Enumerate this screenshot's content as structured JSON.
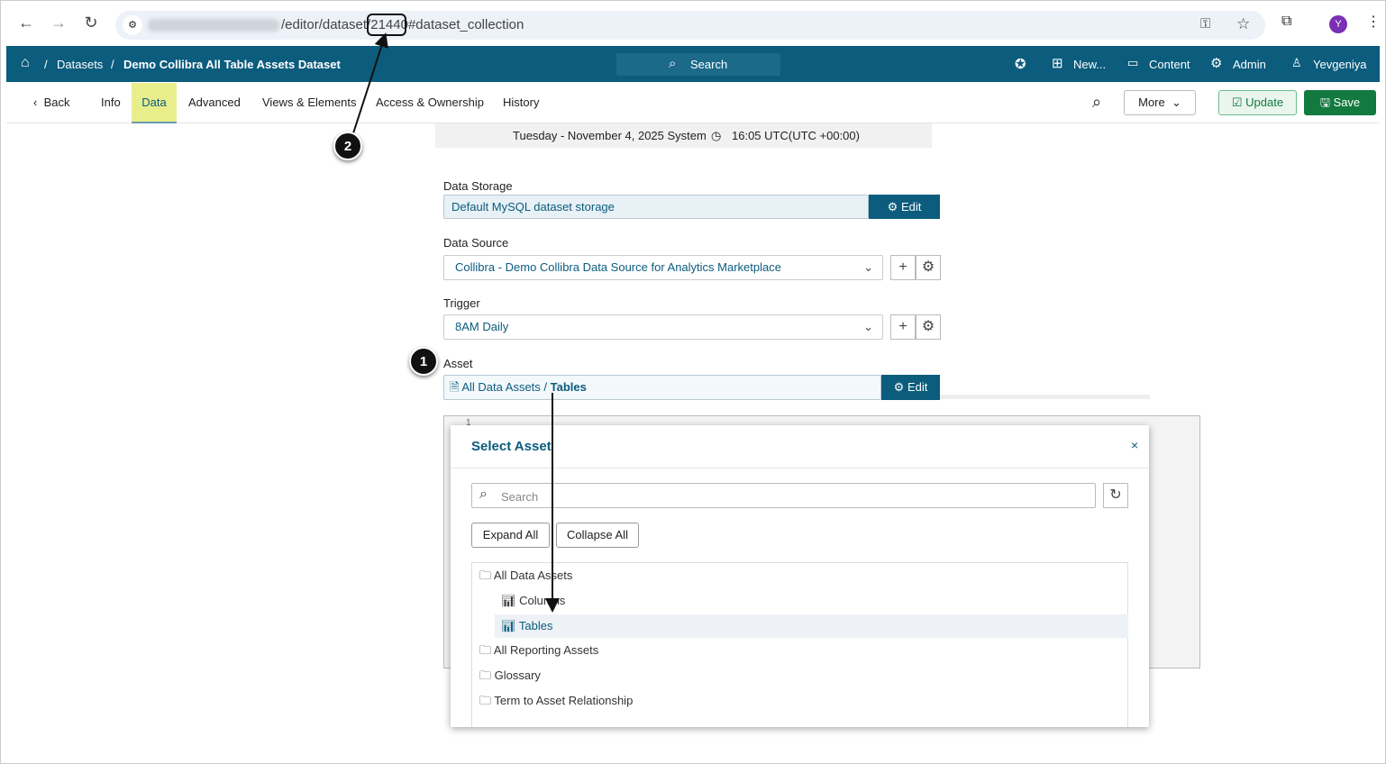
{
  "browser": {
    "url_path": "/editor/dataset/21440#dataset_collection",
    "avatar_letter": "Y"
  },
  "appbar": {
    "breadcrumb": [
      "Datasets",
      "Demo Collibra All Table Assets Dataset"
    ],
    "search": "Search",
    "new": "New...",
    "content": "Content",
    "admin": "Admin",
    "user": "Yevgeniya"
  },
  "tabs": {
    "back": "Back",
    "items": [
      "Info",
      "Data",
      "Advanced",
      "Views & Elements",
      "Access & Ownership",
      "History"
    ],
    "more": "More",
    "update": "Update",
    "save": "Save"
  },
  "datebar": {
    "date": "Tuesday - November 4, 2025 System",
    "time": "16:05 UTC(UTC +00:00)"
  },
  "form": {
    "storage_label": "Data Storage",
    "storage_value": "Default MySQL dataset storage",
    "edit": "Edit",
    "source_label": "Data Source",
    "source_value": "Collibra - Demo Collibra Data Source for Analytics Marketplace",
    "trigger_label": "Trigger",
    "trigger_value": "8AM Daily",
    "asset_label": "Asset",
    "asset_path": "All Data Assets / ",
    "asset_leaf": "Tables"
  },
  "editor": {
    "line": "1"
  },
  "modal": {
    "title": "Select Asset",
    "search_placeholder": "Search",
    "expand": "Expand All",
    "collapse": "Collapse All",
    "tree": [
      {
        "label": "All Data Assets"
      },
      {
        "label": "Columns"
      },
      {
        "label": "Tables"
      },
      {
        "label": "All Reporting Assets"
      },
      {
        "label": "Glossary"
      },
      {
        "label": "Term to Asset Relationship"
      }
    ]
  },
  "annotations": [
    "1",
    "2"
  ],
  "colors": {
    "brand": "#0b5c7d",
    "save": "#127a3f",
    "active_tab": "#e8ee8c"
  }
}
